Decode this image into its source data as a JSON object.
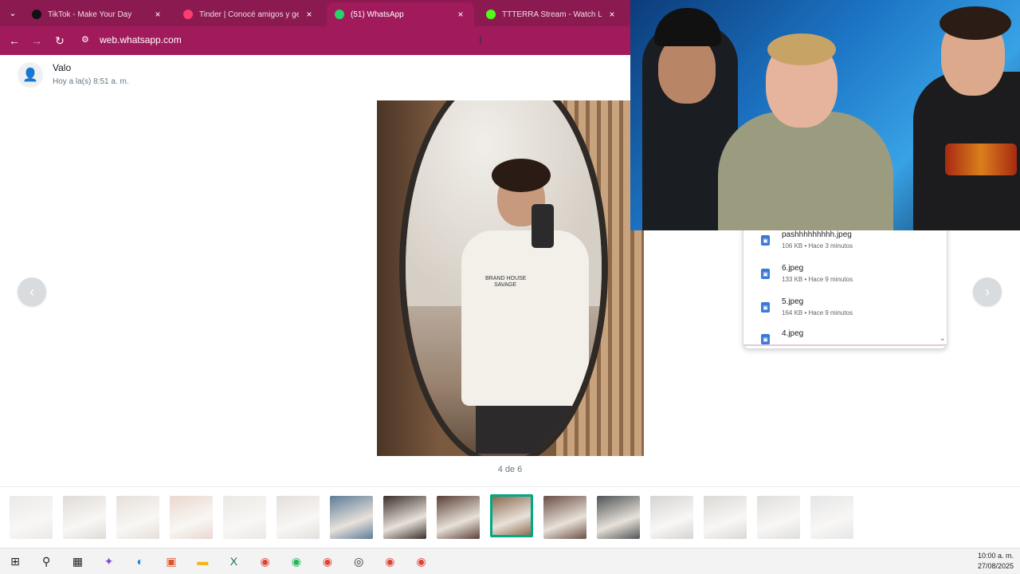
{
  "browser": {
    "tabs": [
      {
        "title": "TikTok - Make Your Day",
        "icon": "tiktok-icon",
        "color": "#111111",
        "active": false
      },
      {
        "title": "Tinder | Conocé amigos y gente",
        "icon": "tinder-flame-icon",
        "color": "#fe3c72",
        "active": false
      },
      {
        "title": "(51) WhatsApp",
        "icon": "whatsapp-icon",
        "color": "#25d366",
        "active": true
      },
      {
        "title": "TTTERRA Stream - Watch Live o",
        "icon": "kick-icon",
        "color": "#53fc18",
        "active": false
      }
    ],
    "url": "web.whatsapp.com",
    "theme_color": "#a11b5c"
  },
  "viewer": {
    "sender_name": "Valo",
    "sender_time": "Hoy a la(s) 8:51 a. m.",
    "counter": "4 de 6",
    "shirt_text": "BRAND HOUSE\nSAVAGE"
  },
  "downloads": [
    {
      "name": "pashhhhhhhhh.jpeg",
      "meta": "106 KB • Hace 3 minutos"
    },
    {
      "name": "6.jpeg",
      "meta": "133 KB • Hace 9 minutos"
    },
    {
      "name": "5.jpeg",
      "meta": "164 KB • Hace 9 minutos"
    },
    {
      "name": "4.jpeg",
      "meta": ""
    }
  ],
  "thumbnails": [
    {
      "color": "#b7b3ad",
      "state": "faded"
    },
    {
      "color": "#8c7f72",
      "state": "faded"
    },
    {
      "color": "#a48e7a",
      "state": "faded"
    },
    {
      "color": "#b4744e",
      "state": "faded"
    },
    {
      "color": "#b8ada2",
      "state": "faded"
    },
    {
      "color": "#9c8b80",
      "state": "faded"
    },
    {
      "color": "#5d7c98",
      "state": "normal"
    },
    {
      "color": "#3b2f2c",
      "state": "normal"
    },
    {
      "color": "#5a3f36",
      "state": "normal"
    },
    {
      "color": "#8d6c52",
      "state": "selected"
    },
    {
      "color": "#6b4e45",
      "state": "normal"
    },
    {
      "color": "#4f5457",
      "state": "normal"
    },
    {
      "color": "#6e645c",
      "state": "faded"
    },
    {
      "color": "#7f756d",
      "state": "faded"
    },
    {
      "color": "#8a8a86",
      "state": "faded"
    },
    {
      "color": "#a3a6a8",
      "state": "faded"
    }
  ],
  "taskbar": {
    "apps": [
      {
        "icon": "windows-start-icon",
        "glyph": "⊞",
        "color": "#1f1f1f"
      },
      {
        "icon": "search-icon",
        "glyph": "⚲",
        "color": "#1f1f1f"
      },
      {
        "icon": "task-view-icon",
        "glyph": "▦",
        "color": "#1f1f1f"
      },
      {
        "icon": "copilot-icon",
        "glyph": "✦",
        "color": "#7a4fd6"
      },
      {
        "icon": "edge-icon",
        "glyph": "◐",
        "color": "#0f7bd6"
      },
      {
        "icon": "store-icon",
        "glyph": "▣",
        "color": "#e0542a"
      },
      {
        "icon": "file-explorer-icon",
        "glyph": "▬",
        "color": "#f2b51c"
      },
      {
        "icon": "excel-icon",
        "glyph": "X",
        "color": "#1e7145"
      },
      {
        "icon": "chrome-icon",
        "glyph": "◉",
        "color": "#db4437"
      },
      {
        "icon": "spotify-icon",
        "glyph": "◉",
        "color": "#1db954"
      },
      {
        "icon": "chrome-profile-icon",
        "glyph": "◉",
        "color": "#db4437"
      },
      {
        "icon": "obs-icon",
        "glyph": "◎",
        "color": "#302e31"
      },
      {
        "icon": "chrome-profile-icon",
        "glyph": "◉",
        "color": "#db4437"
      },
      {
        "icon": "chrome-profile-icon",
        "glyph": "◉",
        "color": "#db4437"
      }
    ],
    "time": "10:00 a. m.",
    "date": "27/08/2025"
  }
}
